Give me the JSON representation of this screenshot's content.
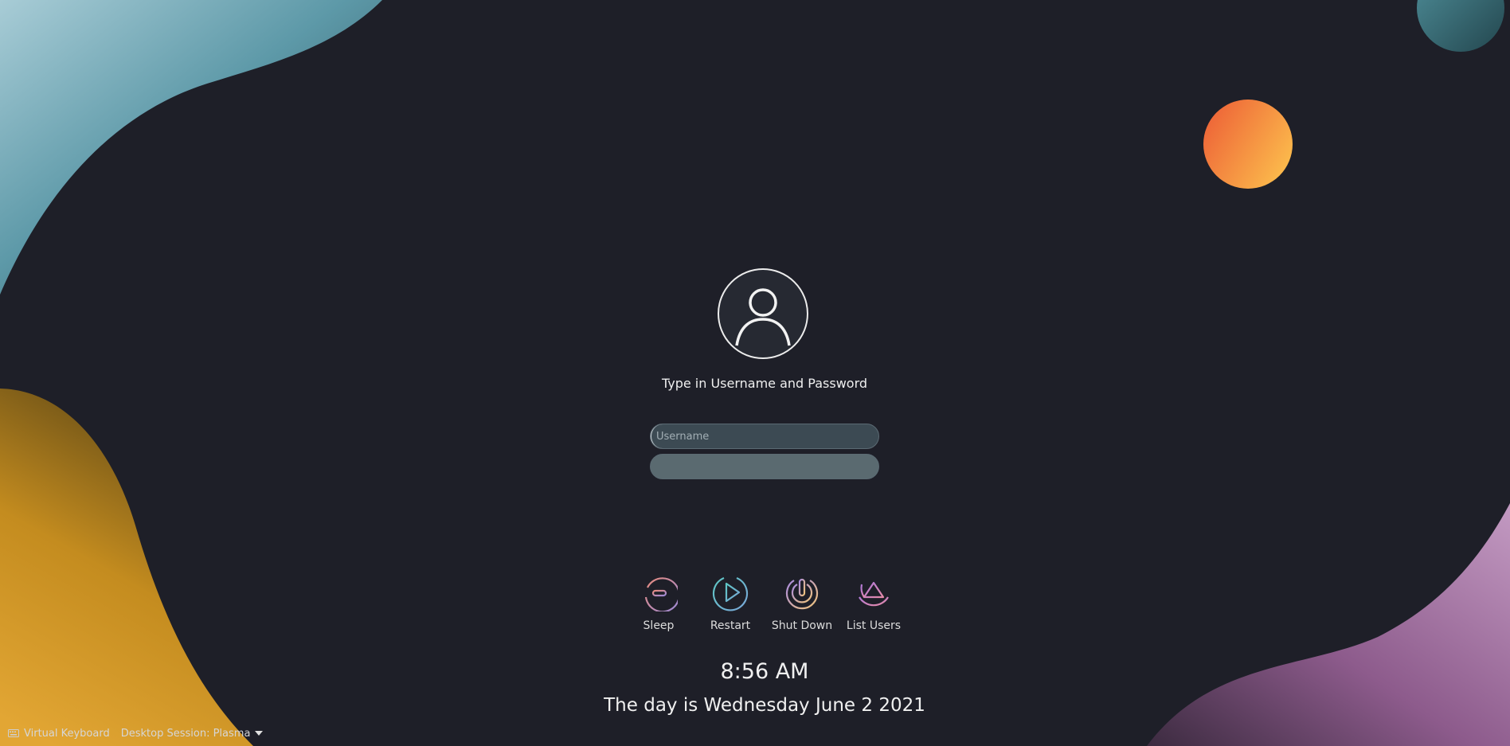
{
  "login": {
    "prompt": "Type in Username and Password",
    "username_placeholder": "Username",
    "username_value": ""
  },
  "actions": [
    {
      "label": "Sleep",
      "icon": "sleep-icon"
    },
    {
      "label": "Restart",
      "icon": "restart-icon"
    },
    {
      "label": "Shut Down",
      "icon": "shutdown-icon"
    },
    {
      "label": "List Users",
      "icon": "list-users-icon"
    }
  ],
  "clock": {
    "time": "8:56 AM",
    "date": "The day is Wednesday June 2 2021"
  },
  "bottom_bar": {
    "virtual_keyboard": "Virtual Keyboard",
    "desktop_session": "Desktop Session: Plasma"
  },
  "colors": {
    "background": "#1e1f28",
    "sun_start": "#ec5a35",
    "sun_end": "#fbb74b",
    "teal": "#5d99a8",
    "gold": "#d9a02a",
    "mauve": "#a071a0"
  }
}
